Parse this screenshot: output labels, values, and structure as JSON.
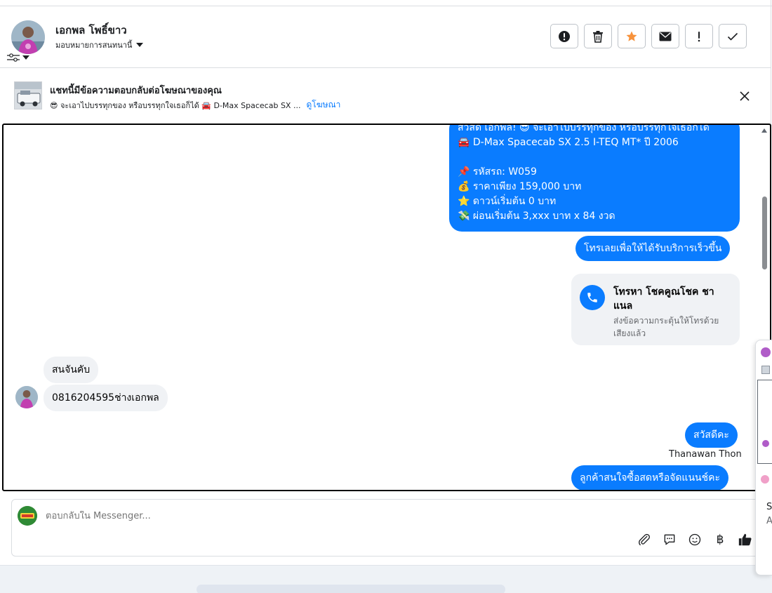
{
  "header": {
    "name": "เอกพล โพธิ์ขาว",
    "assign_label": "มอบหมายการสนทนานี้"
  },
  "ad_banner": {
    "title": "แชทนี้มีข้อความตอบกลับต่อโฆษณาของคุณ",
    "subtitle": "😎 จะเอาไปบรรทุกของ หรือบรรทุกใจเธอก็ได้ 🚘 D-Max Spacecab SX ...",
    "link": "ดูโฆษณา"
  },
  "messages": {
    "m1": {
      "line1": "สวัสดี เอกพล! 😎 จะเอาไปบรรทุกของ หรือบรรทุกใจเธอก็ได้",
      "line2": "🚘 D-Max Spacecab SX 2.5 I-TEQ MT* ปี 2006",
      "line3": "📌 รหัสรถ: W059",
      "line4": "💰 ราคาเพียง 159,000 บาท",
      "line5": "⭐ ดาวน์เริ่มต้น 0 บาท",
      "line6": "💸 ผ่อนเริ่มต้น 3,xxx บาท x 84 งวด"
    },
    "m2": "โทรเลยเพื่อให้ได้รับบริการเร็วขึ้น",
    "call_card": {
      "title": "โทรหา โชคคูณโชค ชาแนล",
      "subtitle": "ส่งข้อความกระตุ้นให้โทรด้วยเสียงแล้ว"
    },
    "m3": "สนจันคับ",
    "m4": "0816204595ช่างเอกพล",
    "m5": "สวัสดีคะ",
    "sender": "Thanawan Thon",
    "m6": "ลูกค้าสนใจซื้อสดหรือจัดแนนช์คะ"
  },
  "composer": {
    "placeholder": "ตอบกลับใน Messenger..."
  },
  "side_peek": {
    "letter1": "S",
    "letter2": "A"
  },
  "colors": {
    "accent": "#0a7cff",
    "incoming_bubble": "#f0f2f5",
    "star": "#f7923b"
  }
}
